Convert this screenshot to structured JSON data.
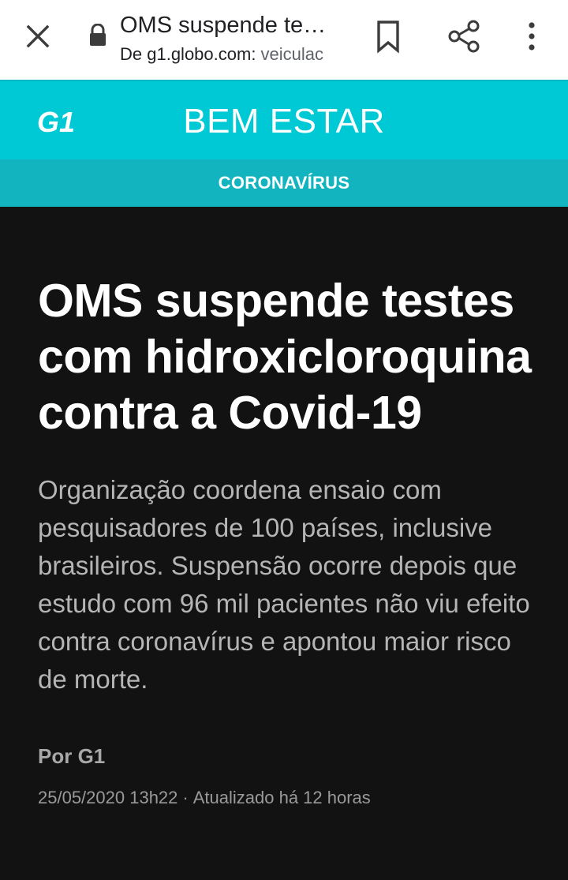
{
  "browser": {
    "tab_title": "OMS suspende te…",
    "url_host": "De g1.globo.com:",
    "url_rest": " veiculac"
  },
  "header": {
    "logo_text": "G1",
    "section": "BEM ESTAR",
    "subsection": "CORONAVÍRUS",
    "colors": {
      "primary": "#00c9d6",
      "secondary": "#12b4bf"
    }
  },
  "article": {
    "headline": "OMS suspende testes com hidroxicloroquina contra a Covid-19",
    "summary": "Organização coordena ensaio com pesquisadores de 100 países, inclusive brasileiros. Suspensão ocorre depois que estudo com 96 mil pacientes não viu efeito contra coronavírus e apontou maior risco de morte.",
    "byline": "Por G1",
    "date": "25/05/2020 13h22",
    "separator": "·",
    "updated": "Atualizado há 12 horas"
  },
  "icons": {
    "close": "close-icon",
    "lock": "lock-icon",
    "bookmark": "bookmark-icon",
    "share": "share-icon",
    "menu": "more-vert-icon"
  }
}
